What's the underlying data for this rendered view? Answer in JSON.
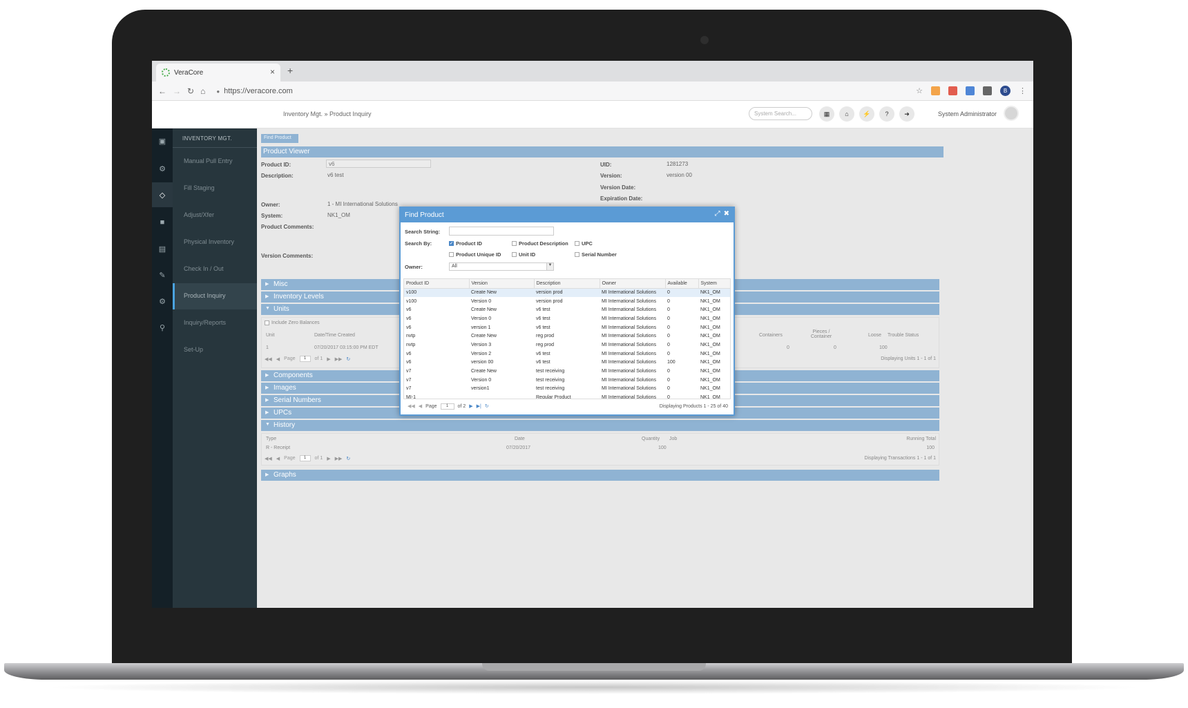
{
  "browser": {
    "tab_title": "VeraCore",
    "tab_close": "×",
    "new_tab": "+",
    "url": "https://veracore.com",
    "profile_initial": "B"
  },
  "header": {
    "breadcrumb": "Inventory Mgt. » Product Inquiry",
    "search_placeholder": "System Search...",
    "user": "System Administrator"
  },
  "sidebar": {
    "title": "INVENTORY MGT.",
    "items": [
      {
        "label": "Manual Pull Entry"
      },
      {
        "label": "Fill Staging"
      },
      {
        "label": "Adjust/Xfer"
      },
      {
        "label": "Physical Inventory"
      },
      {
        "label": "Check In / Out"
      },
      {
        "label": "Product Inquiry"
      },
      {
        "label": "Inquiry/Reports"
      },
      {
        "label": "Set-Up"
      }
    ]
  },
  "viewer": {
    "find_button": "Find Product",
    "title": "Product Viewer",
    "product_id_label": "Product ID:",
    "product_id": "v6",
    "description_label": "Description:",
    "description": "v6 test",
    "owner_label": "Owner:",
    "owner": "1 - MI International Solutions",
    "system_label": "System:",
    "system": "NK1_OM",
    "product_comments_label": "Product Comments:",
    "version_comments_label": "Version Comments:",
    "uid_label": "UID:",
    "uid": "1281273",
    "version_label": "Version:",
    "version": "version 00",
    "version_date_label": "Version Date:",
    "expiration_date_label": "Expiration Date:"
  },
  "sections": {
    "misc": "Misc",
    "inventory_levels": "Inventory Levels",
    "units": "Units",
    "components": "Components",
    "images": "Images",
    "serial_numbers": "Serial Numbers",
    "upcs": "UPCs",
    "history": "History",
    "graphs": "Graphs"
  },
  "units": {
    "include_zero": "Include Zero Balances",
    "col_unit": "Unit",
    "col_datetime": "Date/Time Created",
    "col_containers": "Containers",
    "col_pieces": "Pieces / Container",
    "col_loose": "Loose",
    "col_trouble": "Trouble Status",
    "row_unit": "1",
    "row_datetime": "07/20/2017 03:15:00 PM EDT",
    "row_containers": "0",
    "row_pieces": "0",
    "row_loose": "100",
    "page_label": "Page",
    "page": "1",
    "of": "of 1",
    "displaying": "Displaying Units 1 - 1 of 1"
  },
  "history": {
    "col_type": "Type",
    "col_date": "Date",
    "col_quantity": "Quantity",
    "col_job": "Job",
    "col_running": "Running Total",
    "row_type": "R - Receipt",
    "row_date": "07/20/2017",
    "row_quantity": "100",
    "row_running": "100",
    "page_label": "Page",
    "page": "1",
    "of": "of 1",
    "displaying": "Displaying Transactions 1 - 1 of 1"
  },
  "dialog": {
    "title": "Find Product",
    "search_string_label": "Search String:",
    "search_string": "",
    "search_by_label": "Search By:",
    "options": [
      {
        "label": "Product ID",
        "checked": true
      },
      {
        "label": "Product Description",
        "checked": false
      },
      {
        "label": "UPC",
        "checked": false
      },
      {
        "label": "Product Unique ID",
        "checked": false
      },
      {
        "label": "Unit ID",
        "checked": false
      },
      {
        "label": "Serial Number",
        "checked": false
      }
    ],
    "owner_label": "Owner:",
    "owner_value": "All",
    "columns": [
      "Product ID",
      "Version",
      "Description",
      "Owner",
      "Available",
      "System"
    ],
    "rows": [
      [
        "v100",
        "Create New",
        "version prod",
        "MI International Solutions",
        "0",
        "NK1_OM"
      ],
      [
        "v100",
        "Version 0",
        "version prod",
        "MI International Solutions",
        "0",
        "NK1_OM"
      ],
      [
        "v6",
        "Create New",
        "v6 test",
        "MI International Solutions",
        "0",
        "NK1_OM"
      ],
      [
        "v6",
        "Version 0",
        "v6 test",
        "MI International Solutions",
        "0",
        "NK1_OM"
      ],
      [
        "v6",
        "version 1",
        "v6 test",
        "MI International Solutions",
        "0",
        "NK1_OM"
      ],
      [
        "nvtp",
        "Create New",
        "reg prod",
        "MI International Solutions",
        "0",
        "NK1_OM"
      ],
      [
        "nvtp",
        "Version 3",
        "reg prod",
        "MI International Solutions",
        "0",
        "NK1_OM"
      ],
      [
        "v6",
        "Version 2",
        "v6 test",
        "MI International Solutions",
        "0",
        "NK1_OM"
      ],
      [
        "v6",
        "version 00",
        "v6 test",
        "MI International Solutions",
        "100",
        "NK1_OM"
      ],
      [
        "v7",
        "Create New",
        "test receiving",
        "MI International Solutions",
        "0",
        "NK1_OM"
      ],
      [
        "v7",
        "Version 0",
        "test receiving",
        "MI International Solutions",
        "0",
        "NK1_OM"
      ],
      [
        "v7",
        "version1",
        "test receiving",
        "MI International Solutions",
        "0",
        "NK1_OM"
      ],
      [
        "MI-1",
        "",
        "Regular Product",
        "MI International Solutions",
        "0",
        "NK1_OM"
      ]
    ],
    "page_label": "Page",
    "page": "1",
    "of": "of 2",
    "displaying": "Displaying Products 1 - 25 of 40"
  },
  "colors": {
    "accent": "#5b9bd5",
    "section": "#8fb3d3",
    "sidebar": "#27363d",
    "iconbar": "#142027"
  }
}
